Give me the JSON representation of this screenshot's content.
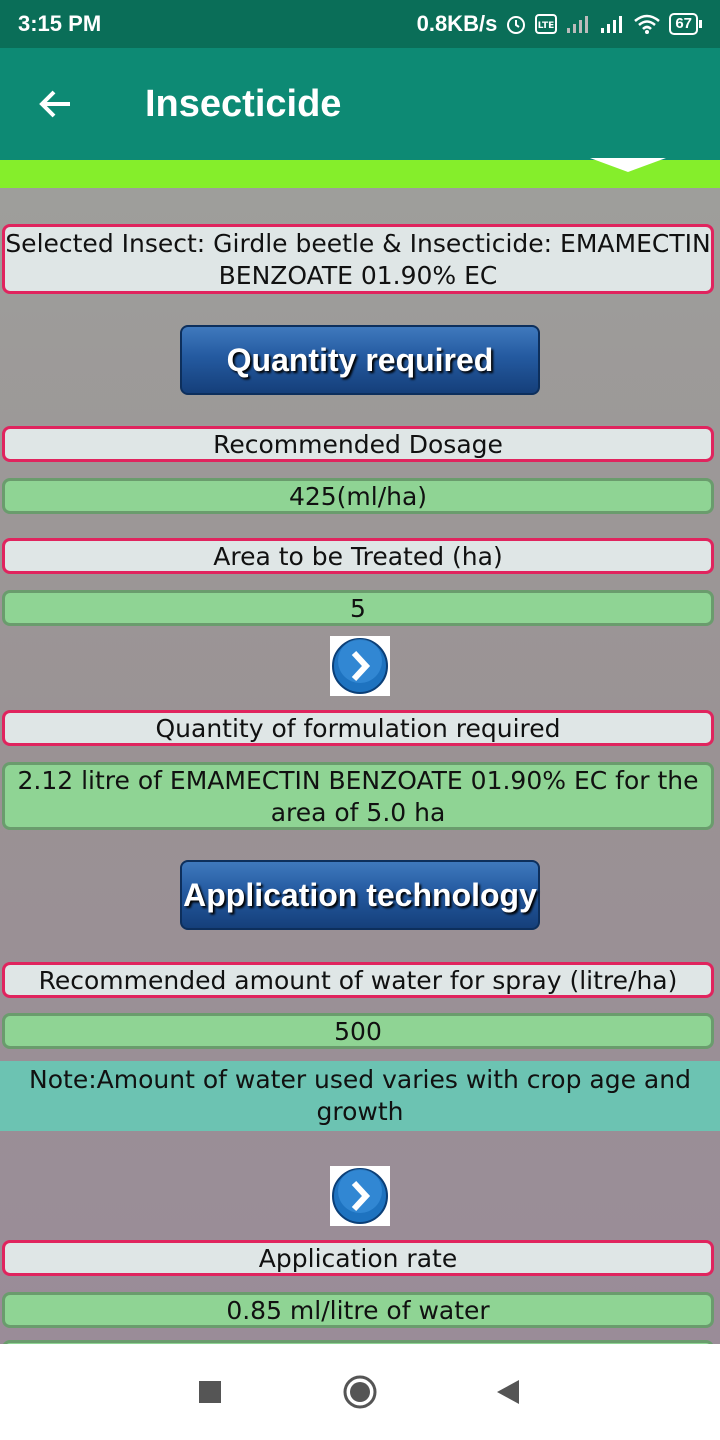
{
  "status_bar": {
    "time": "3:15 PM",
    "net_speed": "0.8KB/s",
    "battery": "67",
    "icons": [
      "alarm-icon",
      "volte-icon",
      "signal-icon",
      "signal-icon",
      "wifi-icon",
      "battery-icon"
    ]
  },
  "app_bar": {
    "title": "Insecticide",
    "back_icon": "arrow-left-icon"
  },
  "selected_info": "Selected Insect: Girdle beetle  & Insecticide:  EMAMECTIN BENZOATE 01.90% EC",
  "buttons": {
    "quantity_required": "Quantity required",
    "application_technology": "Application technology"
  },
  "fields": {
    "recommended_dosage_label": "Recommended Dosage",
    "recommended_dosage_value": "425(ml/ha)",
    "area_label": "Area to be Treated (ha)",
    "area_value": "5",
    "quantity_label": "Quantity of formulation required",
    "quantity_value": "2.12 litre of EMAMECTIN BENZOATE 01.90% EC for the area of 5.0 ha",
    "water_label": "Recommended amount of water for spray (litre/ha)",
    "water_value": "500",
    "note": "Note:Amount of water used varies with crop age and growth",
    "rate_label": "Application rate",
    "rate_value": "0.85 ml/litre of water"
  },
  "colors": {
    "status_bar": "#0a6e58",
    "app_bar": "#0d8a74",
    "accent_strip": "#85ee2b",
    "label_border": "#e0245e",
    "value_bg": "#8fd494",
    "note_bg": "#6cc3b2",
    "button_blue": "#245aa0"
  }
}
